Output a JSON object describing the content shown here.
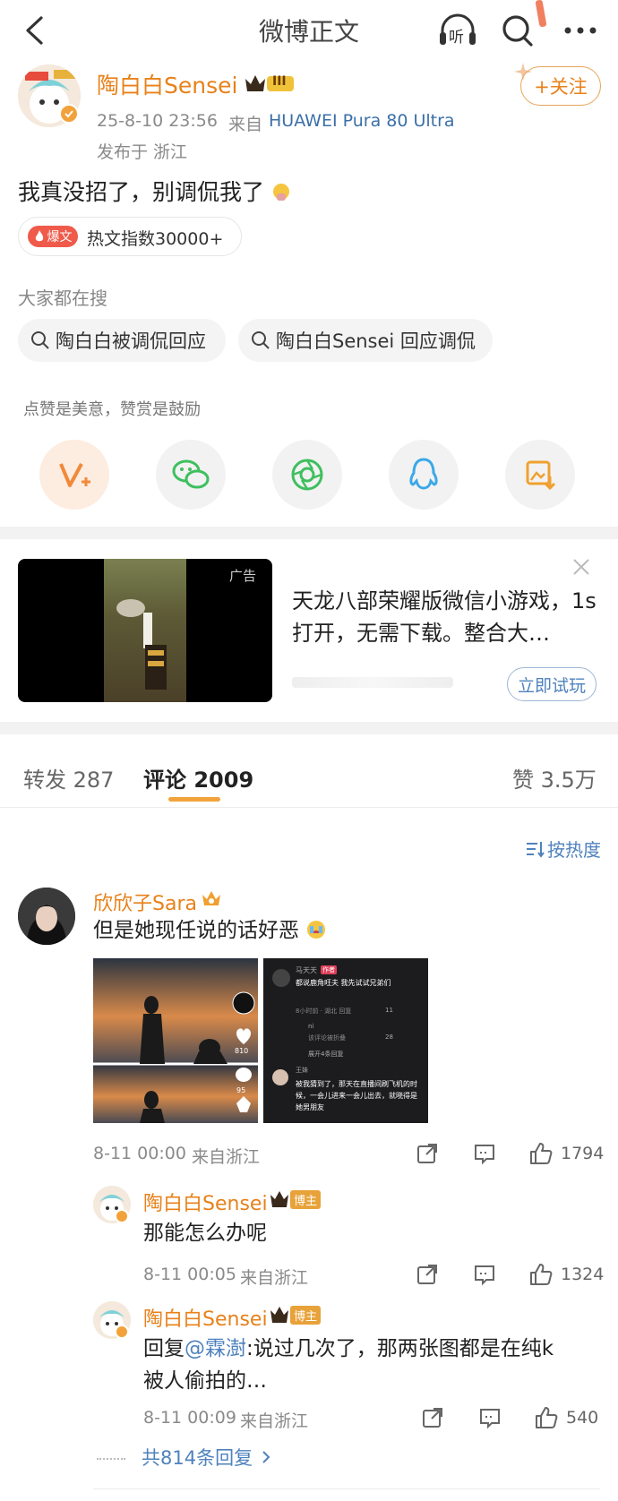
{
  "header": {
    "title": "微博正文",
    "listen_label": "听"
  },
  "post": {
    "author": "陶白白Sensei",
    "level_badge": "III",
    "time": "25-8-10 23:56",
    "from_prefix": "来自",
    "device": "HUAWEI Pura 80 Ultra",
    "location": "发布于 浙江",
    "follow_label": "+关注",
    "content": "我真没招了，别调侃我了",
    "hot_badge": "爆文",
    "hot_index": "热文指数30000+",
    "search_heading": "大家都在搜",
    "search_chips": [
      "陶白白被调侃回应",
      "陶白白Sensei 回应调侃"
    ],
    "tip": "点赞是美意，赞赏是鼓励",
    "share_icons": [
      "reward-v-icon",
      "wechat-icon",
      "moments-icon",
      "qq-icon",
      "save-image-icon"
    ]
  },
  "ad": {
    "tag": "广告",
    "text": "天龙八部荣耀版微信小游戏，1s打开，无需下载。整合大…",
    "button": "立即试玩"
  },
  "tabs": {
    "repost": "转发 287",
    "comment": "评论 2009",
    "like": "赞 3.5万"
  },
  "sort_label": "按热度",
  "comments": [
    {
      "user": "欣欣子Sara",
      "text": "但是她现任说的话好恶",
      "time": "8-11 00:00",
      "from": "来自浙江",
      "likes": "1794",
      "image_like_count": "810",
      "image_comment_count": "95",
      "image2": {
        "name": "马天天",
        "author_tag": "作者",
        "line1": "都说鹿角旺夫 我先试试兄弟们",
        "meta": "8小时前 · 湖北    回复",
        "likes_a": "11",
        "reply_name": "ni",
        "reply_meta": "该评论被折叠",
        "likes_b": "28",
        "expand": "展开4条回复",
        "name2": "王妹",
        "line2": "被我猜到了，那天在直播间刷飞机的时候，一会儿进来一会儿出去，就晓得是她男朋友"
      }
    }
  ],
  "replies": [
    {
      "user": "陶白白Sensei",
      "host_tag": "博主",
      "text": "那能怎么办呢",
      "time": "8-11 00:05",
      "from": "来自浙江",
      "likes": "1324"
    },
    {
      "user": "陶白白Sensei",
      "host_tag": "博主",
      "text_prefix": "回复",
      "mention": "@霖澍",
      "text_rest": ":说过几次了，那两张图都是在纯k",
      "text_line2": "被人偷拍的…",
      "time": "8-11 00:09",
      "from": "来自浙江",
      "likes": "540"
    }
  ],
  "more_replies": "共814条回复",
  "colors": {
    "orange": "#e8811a",
    "link_blue": "#4f82bd",
    "gray_text": "#8a8a8a"
  }
}
